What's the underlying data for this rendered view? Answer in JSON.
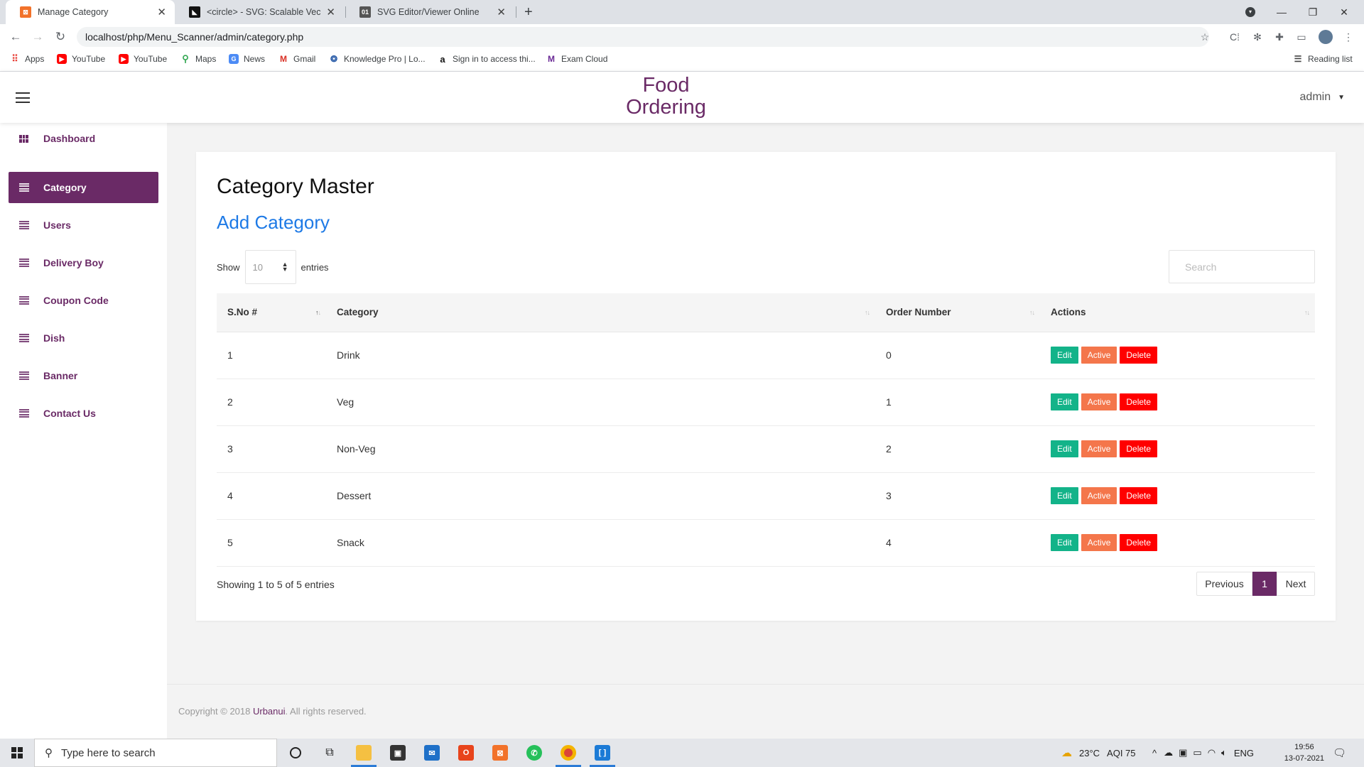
{
  "browser": {
    "tabs": [
      {
        "title": "Manage Category",
        "active": true
      },
      {
        "title": "<circle> - SVG: Scalable Vector G",
        "active": false
      },
      {
        "title": "SVG Editor/Viewer Online",
        "active": false
      }
    ],
    "url": "localhost/php/Menu_Scanner/admin/category.php",
    "bookmarks": [
      "Apps",
      "YouTube",
      "YouTube",
      "Maps",
      "News",
      "Gmail",
      "Knowledge Pro | Lo...",
      "Sign in to access thi...",
      "Exam Cloud"
    ],
    "reading_list": "Reading list"
  },
  "header": {
    "brand_line1": "Food",
    "brand_line2": "Ordering",
    "user": "admin"
  },
  "sidebar": {
    "items": [
      {
        "label": "Dashboard",
        "active": false
      },
      {
        "label": "Category",
        "active": true
      },
      {
        "label": "Users",
        "active": false
      },
      {
        "label": "Delivery Boy",
        "active": false
      },
      {
        "label": "Coupon Code",
        "active": false
      },
      {
        "label": "Dish",
        "active": false
      },
      {
        "label": "Banner",
        "active": false
      },
      {
        "label": "Contact Us",
        "active": false
      }
    ]
  },
  "main": {
    "title": "Category Master",
    "add_link": "Add Category",
    "length": {
      "show": "Show",
      "value": "10",
      "entries": "entries"
    },
    "search_placeholder": "Search",
    "columns": [
      "S.No #",
      "Category",
      "Order Number",
      "Actions"
    ],
    "rows": [
      {
        "sno": "1",
        "category": "Drink",
        "order": "0"
      },
      {
        "sno": "2",
        "category": "Veg",
        "order": "1"
      },
      {
        "sno": "3",
        "category": "Non-Veg",
        "order": "2"
      },
      {
        "sno": "4",
        "category": "Dessert",
        "order": "3"
      },
      {
        "sno": "5",
        "category": "Snack",
        "order": "4"
      }
    ],
    "actions": {
      "edit": "Edit",
      "active": "Active",
      "delete": "Delete"
    },
    "info": "Showing 1 to 5 of 5 entries",
    "pager": {
      "prev": "Previous",
      "current": "1",
      "next": "Next"
    }
  },
  "footer": {
    "prefix": "Copyright © 2018 ",
    "link": "Urbanui",
    "suffix": ". All rights reserved."
  },
  "taskbar": {
    "search_placeholder": "Type here to search",
    "weather": "23°C",
    "aqi": "AQI 75",
    "lang": "ENG",
    "time": "19:56",
    "date": "13-07-2021"
  },
  "colors": {
    "brand": "#6a2a66",
    "link": "#1e7ae6",
    "edit": "#13b389",
    "active": "#f4764b",
    "delete": "#ff0000"
  }
}
